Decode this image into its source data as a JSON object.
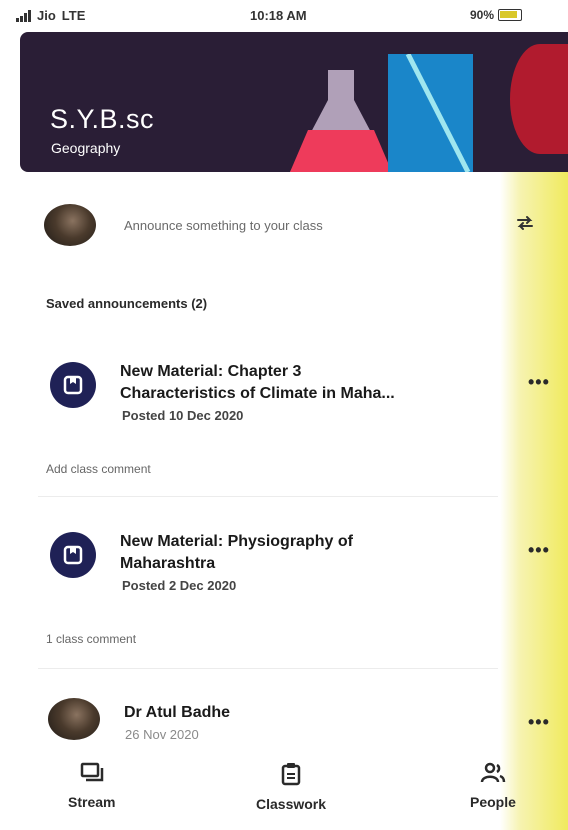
{
  "status_bar": {
    "carrier": "Jio",
    "network": "LTE",
    "time": "10:18 AM",
    "battery": "90%"
  },
  "header": {
    "title": "S.Y.B.sc",
    "subtitle": "Geography"
  },
  "announce": {
    "placeholder": "Announce something to your class"
  },
  "saved_announcements": {
    "label": "Saved announcements (2)"
  },
  "materials": [
    {
      "title_line1": "New Material: Chapter 3",
      "title_line2": "Characteristics of Climate in Maha...",
      "date": "Posted 10 Dec 2020",
      "comment": "Add class comment"
    },
    {
      "title_line1": "New Material: Physiography of",
      "title_line2": "Maharashtra",
      "date": "Posted 2 Dec 2020",
      "comment": "1 class comment"
    }
  ],
  "post": {
    "author": "Dr Atul Badhe",
    "date": "26 Nov 2020"
  },
  "more_label": "•••",
  "nav": {
    "stream": "Stream",
    "classwork": "Classwork",
    "people": "People"
  },
  "colors": {
    "banner_bg": "#2a1e36",
    "material_icon_bg": "#1f2156",
    "accent_yellow": "#f0ea5e"
  }
}
